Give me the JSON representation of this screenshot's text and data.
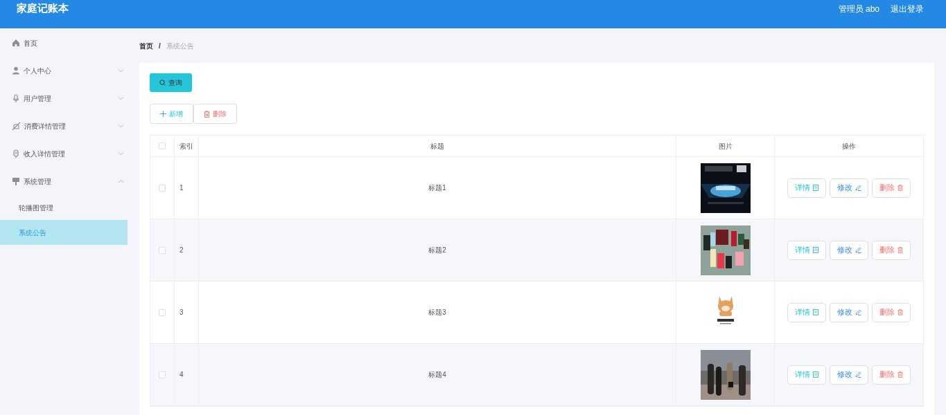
{
  "header": {
    "title": "家庭记账本",
    "user": "管理员 abo",
    "logout": "退出登录"
  },
  "sidebar": {
    "items": [
      {
        "label": "首页",
        "kind": "home"
      },
      {
        "label": "个人中心",
        "kind": "user",
        "expanded": false
      },
      {
        "label": "用户管理",
        "kind": "mic",
        "expanded": false
      },
      {
        "label": "消费详情管理",
        "kind": "bell",
        "expanded": false
      },
      {
        "label": "收入详情管理",
        "kind": "mic2",
        "expanded": false
      },
      {
        "label": "系统管理",
        "kind": "sign",
        "expanded": true,
        "children": [
          {
            "label": "轮播图管理",
            "selected": false
          },
          {
            "label": "系统公告",
            "selected": true
          }
        ]
      }
    ]
  },
  "breadcrumb": {
    "items": [
      "首页",
      "系统公告"
    ],
    "separator": "/"
  },
  "search_button": "查询",
  "toolbar": [
    {
      "kind": "add",
      "label": "新增"
    },
    {
      "kind": "delete",
      "label": "删除"
    }
  ],
  "table": {
    "select_all_checked": false,
    "columns": [
      "索引",
      "标题",
      "图片",
      "操作"
    ],
    "rows": [
      {
        "index": "1",
        "title": "标题1",
        "checked": false,
        "image": {
          "kind": "picture"
        },
        "actions": [
          {
            "kind": "detail",
            "label": "详情"
          },
          {
            "kind": "edit",
            "label": "修改"
          },
          {
            "kind": "delete",
            "label": "删除"
          }
        ]
      },
      {
        "index": "2",
        "title": "标题2",
        "checked": false,
        "image": {
          "kind": "picture"
        },
        "actions": [
          {
            "kind": "detail",
            "label": "详情"
          },
          {
            "kind": "edit",
            "label": "修改"
          },
          {
            "kind": "delete",
            "label": "删除"
          }
        ]
      },
      {
        "index": "3",
        "title": "标题3",
        "checked": false,
        "image": {
          "kind": "picture"
        },
        "actions": [
          {
            "kind": "detail",
            "label": "详情"
          },
          {
            "kind": "edit",
            "label": "修改"
          },
          {
            "kind": "delete",
            "label": "删除"
          }
        ]
      },
      {
        "index": "4",
        "title": "标题4",
        "checked": false,
        "image": {
          "kind": "picture"
        },
        "actions": [
          {
            "kind": "detail",
            "label": "详情"
          },
          {
            "kind": "edit",
            "label": "修改"
          },
          {
            "kind": "delete",
            "label": "删除"
          }
        ]
      }
    ]
  }
}
